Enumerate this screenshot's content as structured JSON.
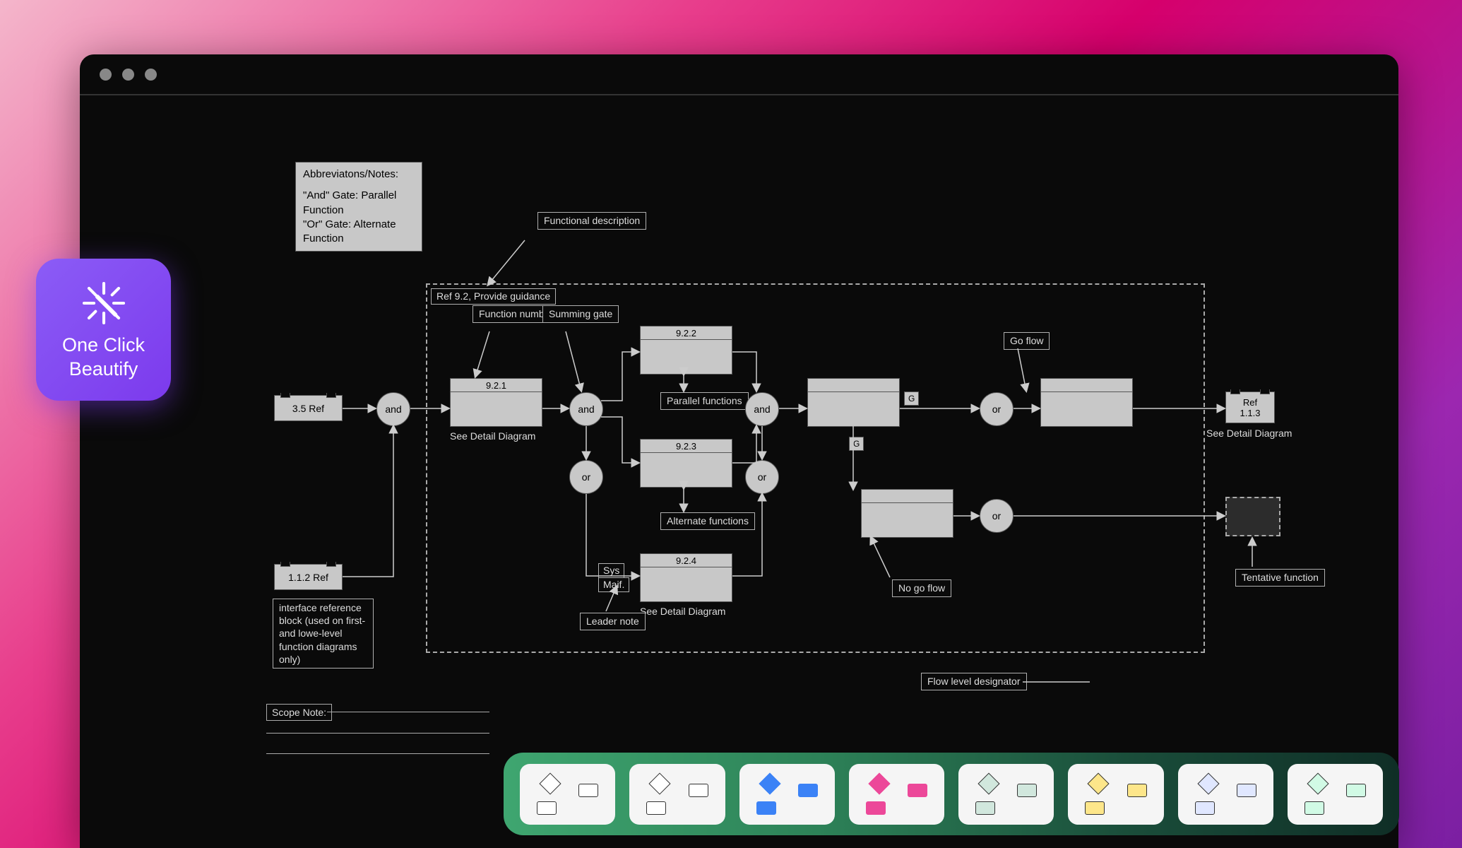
{
  "beautify": {
    "label_line1": "One Click",
    "label_line2": "Beautify"
  },
  "notes": {
    "abbrev_title": "Abbreviatons/Notes:",
    "and_gate": "\"And\" Gate: Parallel Function",
    "or_gate": "\"Or\" Gate: Alternate Function"
  },
  "labels": {
    "functional_description": "Functional description",
    "frame_title": "Ref 9.2, Provide guidance",
    "function_number": "Function number",
    "summing_gate": "Summing gate",
    "parallel_functions": "Parallel functions",
    "alternate_functions": "Alternate functions",
    "leader_note": "Leader note",
    "sys": "Sys",
    "maif": "Maif.",
    "go_flow": "Go flow",
    "no_go_flow": "No go flow",
    "tentative_function": "Tentative function",
    "flow_level_designator": "Flow level designator",
    "scope_note": "Scope Note:",
    "interface_note": "interface reference block (used on first- and lowe-level function diagrams only)",
    "see_detail_1": "See Detail Diagram",
    "see_detail_2": "See Detail Diagram",
    "see_detail_3": "See Detail Diagram",
    "g1": "G",
    "g2": "G"
  },
  "refs": {
    "r35": "3.5 Ref",
    "r112": "1.1.2 Ref",
    "r113_top": "Ref",
    "r113_bot": "1.1.3"
  },
  "blocks": {
    "b921": "9.2.1",
    "b922": "9.2.2",
    "b923": "9.2.3",
    "b924": "9.2.4"
  },
  "gates": {
    "and": "and",
    "or": "or"
  },
  "styles": [
    {
      "diamond": "#ffffff",
      "box1": "#ffffff",
      "box2": "#ffffff"
    },
    {
      "diamond": "#ffffff",
      "box1": "#ffffff",
      "box2": "#ffffff"
    },
    {
      "diamond": "#3b82f6",
      "box1": "#3b82f6",
      "box2": "#3b82f6"
    },
    {
      "diamond": "#ec4899",
      "box1": "#ec4899",
      "box2": "#ec4899"
    },
    {
      "diamond": "#d1e7dd",
      "box1": "#d1e7dd",
      "box2": "#d1e7dd"
    },
    {
      "diamond": "#fde68a",
      "box1": "#fde68a",
      "box2": "#fde68a"
    },
    {
      "diamond": "#e0e7ff",
      "box1": "#e0e7ff",
      "box2": "#e0e7ff"
    },
    {
      "diamond": "#d1fae5",
      "box1": "#d1fae5",
      "box2": "#d1fae5"
    }
  ]
}
